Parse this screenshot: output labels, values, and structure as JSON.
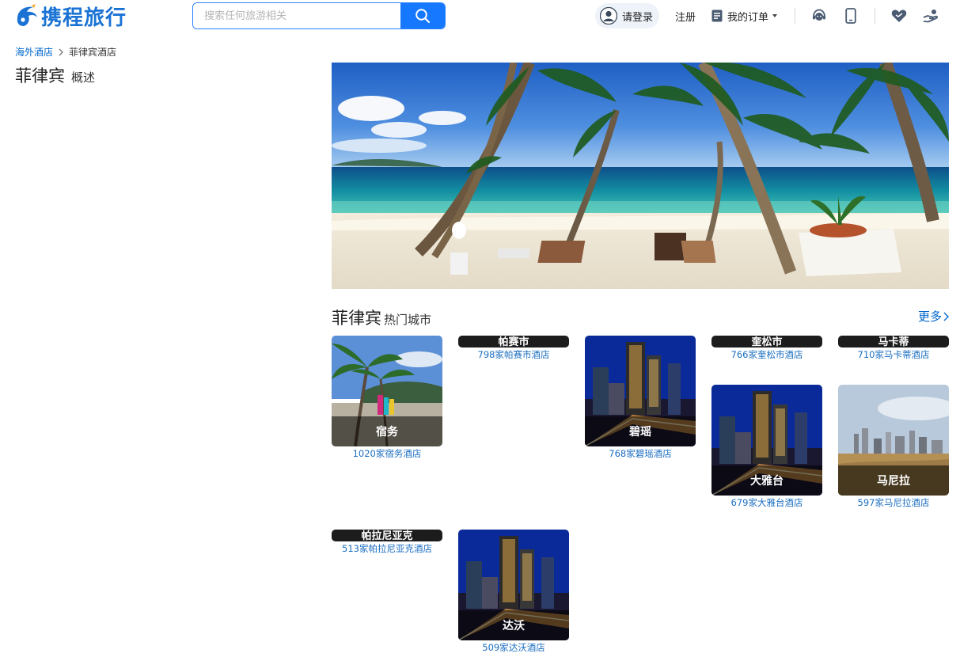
{
  "header": {
    "logo_text": "携程旅行",
    "search_placeholder": "搜索任何旅游相关",
    "login_label": "请登录",
    "register_label": "注册",
    "orders_label": "我的订单",
    "icons": [
      "service-icon",
      "mobile-icon",
      "heart-handshake-icon",
      "hand-icon"
    ]
  },
  "breadcrumb": {
    "root": "海外酒店",
    "current": "菲律宾酒店"
  },
  "title": {
    "country": "菲律宾",
    "overview": "概述"
  },
  "hot_cities": {
    "country": "菲律宾",
    "subtitle": "热门城市",
    "more_label": "更多",
    "cities": [
      {
        "name": "宿务",
        "count": "1020家宿务酒店",
        "image": "beach-palm"
      },
      {
        "name": "帕赛市",
        "count": "798家帕赛市酒店",
        "image": "collapsed"
      },
      {
        "name": "碧瑶",
        "count": "768家碧瑶酒店",
        "image": "city-night"
      },
      {
        "name": "奎松市",
        "count": "766家奎松市酒店",
        "image": "collapsed"
      },
      {
        "name": "马卡蒂",
        "count": "710家马卡蒂酒店",
        "image": "collapsed"
      },
      {
        "name": "大雅台",
        "count": "679家大雅台酒店",
        "image": "city-night"
      },
      {
        "name": "马尼拉",
        "count": "597家马尼拉酒店",
        "image": "bay-skyline"
      },
      {
        "name": "帕拉尼亚克",
        "count": "513家帕拉尼亚克酒店",
        "image": "collapsed"
      },
      {
        "name": "达沃",
        "count": "509家达沃酒店",
        "image": "city-night"
      }
    ]
  },
  "colors": {
    "brand": "#1677ff",
    "link": "#0066cc"
  }
}
